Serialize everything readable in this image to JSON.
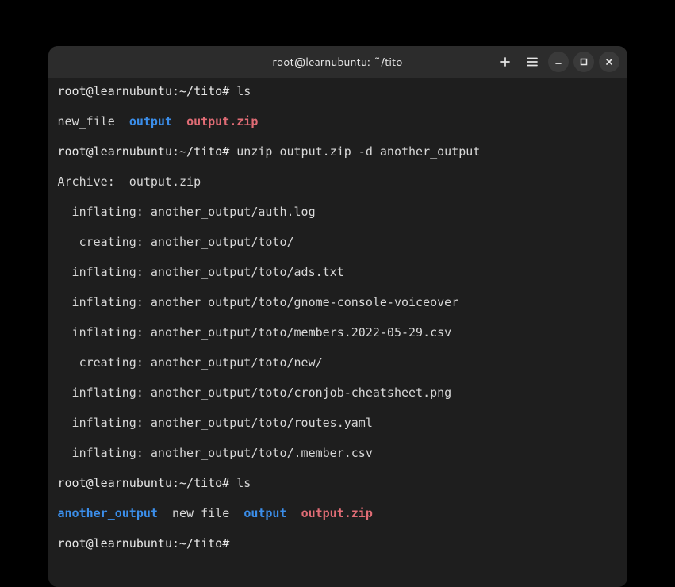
{
  "window": {
    "title": "root@learnubuntu: ~/tito"
  },
  "colors": {
    "dir": "#3b8eea",
    "archive": "#e06c75",
    "text": "#d8d8d8"
  },
  "lines": [
    {
      "segments": [
        {
          "text": "root@learnubuntu",
          "cls": "prompt"
        },
        {
          "text": ":",
          "cls": "c-white"
        },
        {
          "text": "~/tito",
          "cls": "prompt"
        },
        {
          "text": "# ",
          "cls": "c-white"
        },
        {
          "text": "ls",
          "cls": "c-plain"
        }
      ]
    },
    {
      "segments": [
        {
          "text": "new_file  ",
          "cls": "c-plain"
        },
        {
          "text": "output",
          "cls": "c-blue"
        },
        {
          "text": "  ",
          "cls": "c-plain"
        },
        {
          "text": "output.zip",
          "cls": "c-red"
        }
      ]
    },
    {
      "segments": [
        {
          "text": "root@learnubuntu",
          "cls": "prompt"
        },
        {
          "text": ":",
          "cls": "c-white"
        },
        {
          "text": "~/tito",
          "cls": "prompt"
        },
        {
          "text": "# ",
          "cls": "c-white"
        },
        {
          "text": "unzip output.zip -d another_output",
          "cls": "c-plain"
        }
      ]
    },
    {
      "segments": [
        {
          "text": "Archive:  output.zip",
          "cls": "c-plain"
        }
      ]
    },
    {
      "segments": [
        {
          "text": "  inflating: another_output/auth.log",
          "cls": "c-plain"
        }
      ]
    },
    {
      "segments": [
        {
          "text": "   creating: another_output/toto/",
          "cls": "c-plain"
        }
      ]
    },
    {
      "segments": [
        {
          "text": "  inflating: another_output/toto/ads.txt",
          "cls": "c-plain"
        }
      ]
    },
    {
      "segments": [
        {
          "text": "  inflating: another_output/toto/gnome-console-voiceover",
          "cls": "c-plain"
        }
      ]
    },
    {
      "segments": [
        {
          "text": "  inflating: another_output/toto/members.2022-05-29.csv",
          "cls": "c-plain"
        }
      ]
    },
    {
      "segments": [
        {
          "text": "   creating: another_output/toto/new/",
          "cls": "c-plain"
        }
      ]
    },
    {
      "segments": [
        {
          "text": "  inflating: another_output/toto/cronjob-cheatsheet.png",
          "cls": "c-plain"
        }
      ]
    },
    {
      "segments": [
        {
          "text": "  inflating: another_output/toto/routes.yaml",
          "cls": "c-plain"
        }
      ]
    },
    {
      "segments": [
        {
          "text": "  inflating: another_output/toto/.member.csv",
          "cls": "c-plain"
        }
      ]
    },
    {
      "segments": [
        {
          "text": "root@learnubuntu",
          "cls": "prompt"
        },
        {
          "text": ":",
          "cls": "c-white"
        },
        {
          "text": "~/tito",
          "cls": "prompt"
        },
        {
          "text": "# ",
          "cls": "c-white"
        },
        {
          "text": "ls",
          "cls": "c-plain"
        }
      ]
    },
    {
      "segments": [
        {
          "text": "another_output",
          "cls": "c-blue"
        },
        {
          "text": "  new_file  ",
          "cls": "c-plain"
        },
        {
          "text": "output",
          "cls": "c-blue"
        },
        {
          "text": "  ",
          "cls": "c-plain"
        },
        {
          "text": "output.zip",
          "cls": "c-red"
        }
      ]
    },
    {
      "segments": [
        {
          "text": "root@learnubuntu",
          "cls": "prompt"
        },
        {
          "text": ":",
          "cls": "c-white"
        },
        {
          "text": "~/tito",
          "cls": "prompt"
        },
        {
          "text": "# ",
          "cls": "c-white"
        }
      ]
    }
  ]
}
